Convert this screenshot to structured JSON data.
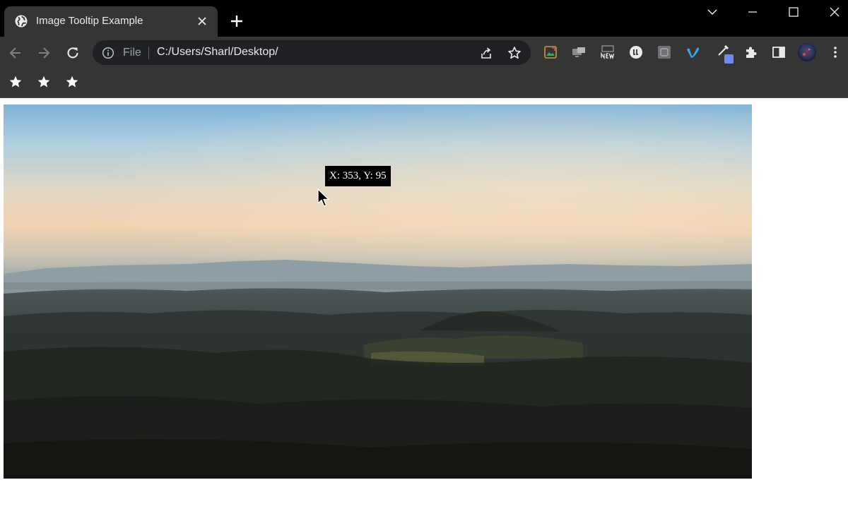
{
  "window": {
    "tab": {
      "title": "Image Tooltip Example",
      "favicon": "globe-icon"
    }
  },
  "toolbar": {
    "address": {
      "scheme_label": "File",
      "url": "C:/Users/Sharl/Desktop/"
    },
    "extension_icons": [
      "photo-editor-icon",
      "screen-share-icon",
      "new-badge-icon",
      "ll-circle-icon",
      "square-extension-icon",
      "vimeo-icon",
      "eyedropper-icon",
      "puzzle-icon",
      "side-panel-icon",
      "profile-avatar-icon",
      "kebab-menu-icon"
    ]
  },
  "bookmarks": {
    "icons": [
      "star-icon",
      "star-icon",
      "star-icon"
    ]
  },
  "page": {
    "tooltip": "X: 353, Y: 95"
  },
  "colors": {
    "tab_strip": "#000000",
    "toolbar": "#353535",
    "omnibox": "#202124",
    "accent_blue": "#4285f4"
  }
}
